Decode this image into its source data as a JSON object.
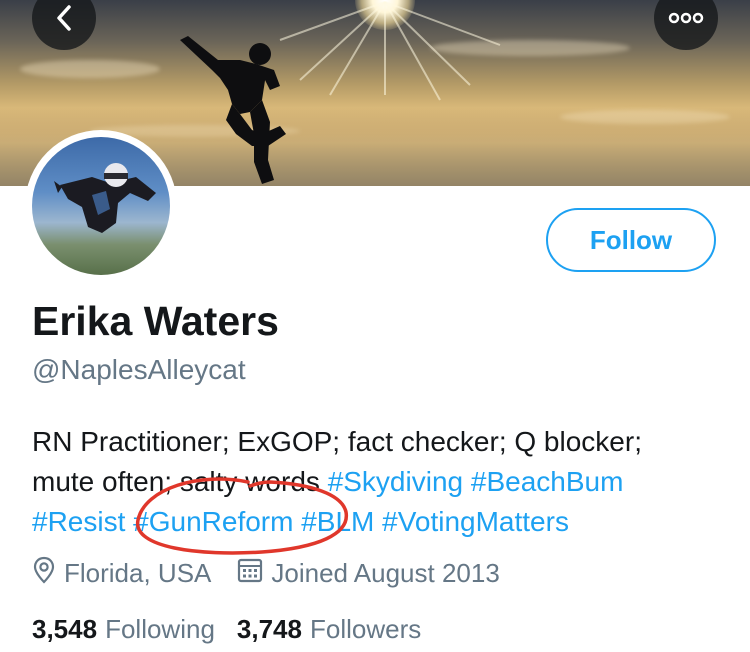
{
  "header": {
    "back_icon": "chevron-left-icon",
    "more_icon": "more-dots-icon"
  },
  "profile": {
    "display_name": "Erika Waters",
    "handle": "@NaplesAlleycat",
    "follow_label": "Follow",
    "bio": {
      "line1": "RN Practitioner; ExGOP; fact checker; Q blocker;",
      "line2_text": "mute often; salty words ",
      "line2_tags": [
        "#Skydiving",
        "#BeachBum"
      ],
      "line3_tags": [
        "#Resist",
        "#GunReform",
        "#BLM",
        "#VotingMatters"
      ]
    },
    "location": "Florida, USA",
    "location_icon": "location-pin-icon",
    "joined": "Joined August 2013",
    "joined_icon": "calendar-icon",
    "following_count": "3,548",
    "following_label": "Following",
    "followers_count": "3,748",
    "followers_label": "Followers"
  },
  "colors": {
    "accent": "#1da1f2",
    "secondary_text": "#657786",
    "primary_text": "#14171a",
    "annotation": "#e0372b"
  }
}
